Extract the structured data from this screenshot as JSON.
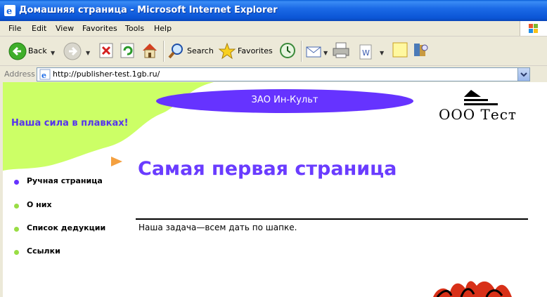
{
  "window": {
    "title": "Домашняя страница - Microsoft Internet Explorer"
  },
  "menu": [
    "File",
    "Edit",
    "View",
    "Favorites",
    "Tools",
    "Help"
  ],
  "toolbar": {
    "back_label": "Back",
    "search_label": "Search",
    "favorites_label": "Favorites"
  },
  "address": {
    "label": "Address",
    "url": "http://publisher-test.1gb.ru/"
  },
  "page": {
    "company_name": "ЗАО Ин-Культ",
    "logo_text": "ООО Тест",
    "tagline": "Наша сила в плавках!",
    "heading": "Самая первая страница",
    "body_text": "Наша задача—всем дать по шапке.",
    "nav": [
      {
        "label": "Ручная страница",
        "active": true
      },
      {
        "label": "О них",
        "active": false
      },
      {
        "label": "Список дедукции",
        "active": false
      },
      {
        "label": "Ссылки",
        "active": false
      }
    ]
  },
  "colors": {
    "accent_purple": "#6633ff",
    "blob_green": "#ccff66",
    "nav_dot_active": "#6633ff",
    "nav_dot": "#99dd44",
    "titlebar_blue": "#0b55d6"
  },
  "icons": [
    "ie-icon",
    "back-arrow-icon",
    "forward-arrow-icon",
    "stop-icon",
    "refresh-icon",
    "home-icon",
    "search-icon",
    "favorites-star-icon",
    "history-icon",
    "mail-icon",
    "print-icon",
    "edit-word-icon",
    "discuss-icon",
    "messenger-icon",
    "ie-page-icon",
    "go-dropdown-icon"
  ]
}
